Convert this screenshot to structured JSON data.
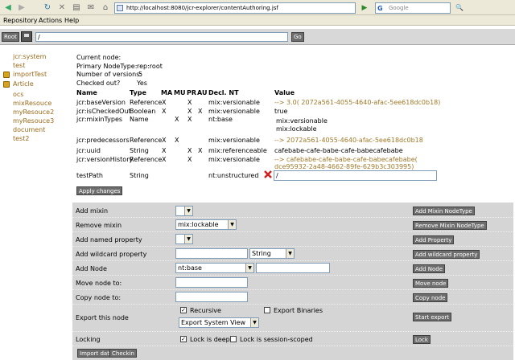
{
  "browser": {
    "url": "http://localhost:8080/jcr-explorer/contentAuthoring.jsf",
    "search_placeholder": "Google",
    "menu": [
      "Repository",
      "Actions",
      "Help"
    ]
  },
  "pathbar": {
    "root_label": "Root",
    "path_value": "/",
    "go_label": "Go"
  },
  "tree": [
    "jcr:system",
    "test",
    "importTest",
    "Article",
    "ocs",
    "mixResouce",
    "myResouce2",
    "myResouce3",
    "document",
    "test2"
  ],
  "node_info": {
    "current_node_label": "Current node:",
    "primary_type_label": "Primary NodeType:",
    "primary_type_value": "rep:root",
    "versions_label": "Number of versions:",
    "versions_value": "5",
    "checked_out_label": "Checked out?",
    "checked_out_value": "Yes"
  },
  "table": {
    "headers": [
      "Name",
      "Type",
      "MA",
      "MU",
      "PR",
      "AU",
      "Decl. NT",
      "Value"
    ],
    "rows": [
      {
        "name": "jcr:baseVersion",
        "type": "Reference",
        "ma": "X",
        "mu": "",
        "pr": "X",
        "au": "",
        "decl": "mix:versionable",
        "value": "--> 3.0( 2072a561-4055-4640-afac-5ee618dc0b18)"
      },
      {
        "name": "jcr:isCheckedOut",
        "type": "Boolean",
        "ma": "X",
        "mu": "",
        "pr": "X",
        "au": "X",
        "decl": "mix:versionable",
        "value": "true"
      },
      {
        "name": "jcr:mixinTypes",
        "type": "Name",
        "ma": "",
        "mu": "X",
        "pr": "X",
        "au": "",
        "decl": "nt:base",
        "value": "mix:versionable",
        "value2": "mix:lockable"
      },
      {
        "name": "jcr:predecessors",
        "type": "Reference",
        "ma": "X",
        "mu": "X",
        "pr": "",
        "au": "",
        "decl": "mix:versionable",
        "value": "--> 2072a561-4055-4640-afac-5ee618dc0b18"
      },
      {
        "name": "jcr:uuid",
        "type": "String",
        "ma": "X",
        "mu": "",
        "pr": "X",
        "au": "X",
        "decl": "mix:referenceable",
        "value": "cafebabe-cafe-babe-cafe-babecafebabe"
      },
      {
        "name": "jcr:versionHistory",
        "type": "Reference",
        "ma": "X",
        "mu": "",
        "pr": "X",
        "au": "",
        "decl": "mix:versionable",
        "value": "--> cafebabe-cafe-babe-cafe-babecafebabe(",
        "value2": "dce95932-2a48-4662-89fe-629b3c303995)"
      },
      {
        "name": "testPath",
        "type": "String",
        "ma": "",
        "mu": "",
        "pr": "",
        "au": "",
        "decl": "nt:unstructured",
        "value": "/"
      }
    ],
    "apply_label": "Apply changes"
  },
  "form": {
    "add_mixin": {
      "label": "Add mixin",
      "button": "Add Mixin NodeType"
    },
    "remove_mixin": {
      "label": "Remove mixin",
      "selected": "mix:lockable",
      "button": "Remove Mixin NodeType"
    },
    "add_named": {
      "label": "Add named property",
      "button": "Add Property"
    },
    "add_wildcard": {
      "label": "Add wildcard property",
      "type_selected": "String",
      "button": "Add wildcard property"
    },
    "add_node": {
      "label": "Add Node",
      "type_selected": "nt:base",
      "button": "Add Node"
    },
    "move_node": {
      "label": "Move node to:",
      "button": "Move node"
    },
    "copy_node": {
      "label": "Copy node to:",
      "button": "Copy node"
    },
    "export": {
      "label": "Export this node",
      "recursive": "Recursive",
      "binaries": "Export Binaries",
      "view_selected": "Export System View",
      "button": "Start export"
    },
    "locking": {
      "label": "Locking",
      "deep": "Lock is deep",
      "session": "Lock is session-scoped",
      "button": "Lock"
    },
    "import_label": "Import data",
    "checkin_label": "Checkin"
  }
}
